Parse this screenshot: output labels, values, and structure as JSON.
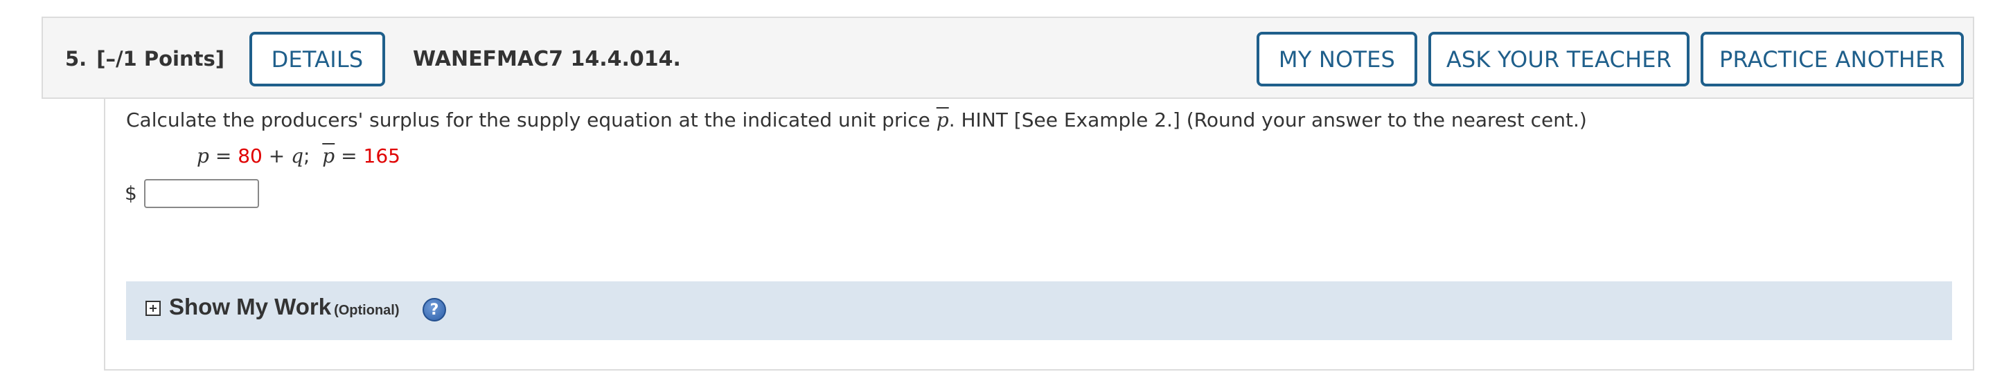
{
  "header": {
    "question_number": "5.",
    "points": "[–/1 Points]",
    "details_label": "DETAILS",
    "assignment_code": "WANEFMAC7 14.4.014.",
    "my_notes_label": "MY NOTES",
    "ask_teacher_label": "ASK YOUR TEACHER",
    "practice_label": "PRACTICE ANOTHER",
    "button_color": "#1f5f8b"
  },
  "question": {
    "prompt_before": "Calculate the producers' surplus for the supply equation at the indicated unit price ",
    "prompt_var": "p",
    "prompt_after": ". HINT [See Example 2.] (Round your answer to the nearest cent.)",
    "equation": {
      "lhs_var": "p",
      "equals": " = ",
      "constant": "80",
      "plus": " + ",
      "rhs_var": "q",
      "separator": ";",
      "price_var": "p",
      "equals2": " = ",
      "price_value": "165",
      "highlight_color": "#e00000"
    },
    "answer": {
      "currency": "$",
      "value": "",
      "placeholder": ""
    }
  },
  "show_work": {
    "title": "Show My Work",
    "optional_label": "(Optional)",
    "help_glyph": "?",
    "icons": [
      "expand-plus-icon",
      "help-icon"
    ]
  }
}
